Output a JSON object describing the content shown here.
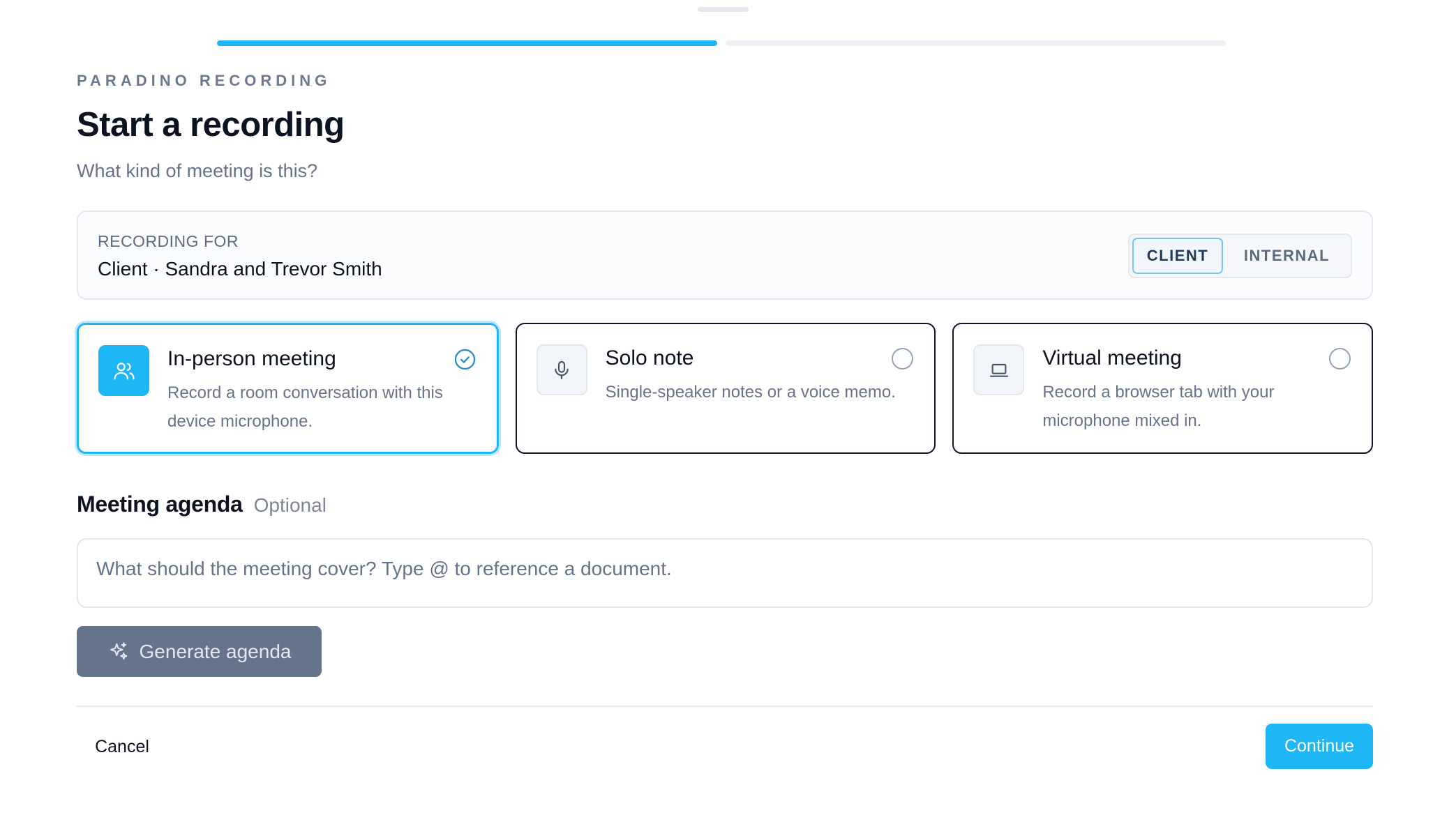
{
  "progress": {
    "steps": 2,
    "current": 1
  },
  "header": {
    "eyebrow": "PARADINO RECORDING",
    "title": "Start a recording",
    "subtitle": "What kind of meeting is this?"
  },
  "recording_for": {
    "label": "RECORDING FOR",
    "value": "Client · Sandra and Trevor Smith",
    "toggle": {
      "options": [
        "CLIENT",
        "INTERNAL"
      ],
      "selected": "CLIENT"
    }
  },
  "meeting_types": [
    {
      "title": "In-person meeting",
      "description": "Record a room conversation with this device microphone.",
      "icon": "users-icon",
      "selected": true
    },
    {
      "title": "Solo note",
      "description": "Single-speaker notes or a voice memo.",
      "icon": "microphone-icon",
      "selected": false
    },
    {
      "title": "Virtual meeting",
      "description": "Record a browser tab with your microphone mixed in.",
      "icon": "laptop-icon",
      "selected": false
    }
  ],
  "agenda": {
    "title": "Meeting agenda",
    "optional_label": "Optional",
    "placeholder": "What should the meeting cover? Type @ to reference a document.",
    "value": "",
    "generate_label": "Generate agenda",
    "generate_icon": "sparkles-icon"
  },
  "footer": {
    "cancel_label": "Cancel",
    "continue_label": "Continue"
  },
  "colors": {
    "accent": "#1fb6f5",
    "muted_button": "#64748b",
    "text_primary": "#0b1220",
    "text_secondary": "#64748b"
  }
}
